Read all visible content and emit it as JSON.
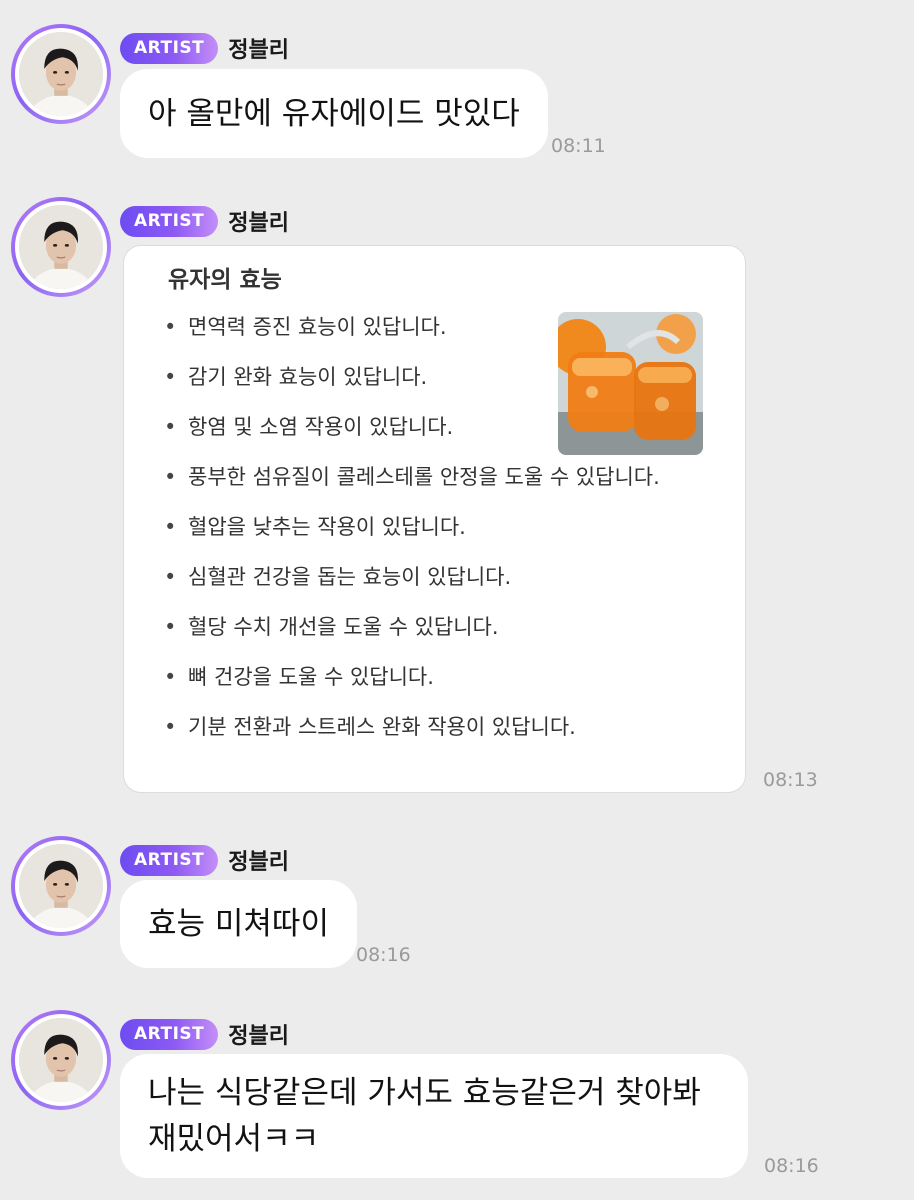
{
  "messages": [
    {
      "badge": "ARTIST",
      "name": "정블리",
      "text": "아 올만에 유자에이드 맛있다",
      "time": "08:11"
    },
    {
      "badge": "ARTIST",
      "name": "정블리",
      "time": "08:13",
      "card": {
        "title": "유자의 효능",
        "items": [
          "면역력 증진 효능이 있답니다.",
          "감기 완화 효능이 있답니다.",
          "항염 및 소염 작용이 있답니다.",
          "풍부한 섬유질이 콜레스테롤 안정을 도울 수 있답니다.",
          "혈압을 낮추는 작용이 있답니다.",
          "심혈관 건강을 돕는 효능이 있답니다.",
          "혈당 수치 개선을 도울 수 있답니다.",
          "뼈 건강을 도울 수 있답니다.",
          "기분 전환과 스트레스 완화 작용이 있답니다."
        ],
        "image_icon": "yuja-jam-jar-photo"
      }
    },
    {
      "badge": "ARTIST",
      "name": "정블리",
      "text": "효능 미쳐따이",
      "time": "08:16"
    },
    {
      "badge": "ARTIST",
      "name": "정블리",
      "text_line1": "나는 식당같은데 가서도 효능같은거 찾아봐",
      "text_line2": "재밌어서ㅋㅋ",
      "time": "08:16"
    }
  ],
  "colors": {
    "background": "#ececed",
    "badge_start": "#6d4cf2",
    "badge_end": "#c48ef8",
    "time": "#9a9a9a"
  }
}
